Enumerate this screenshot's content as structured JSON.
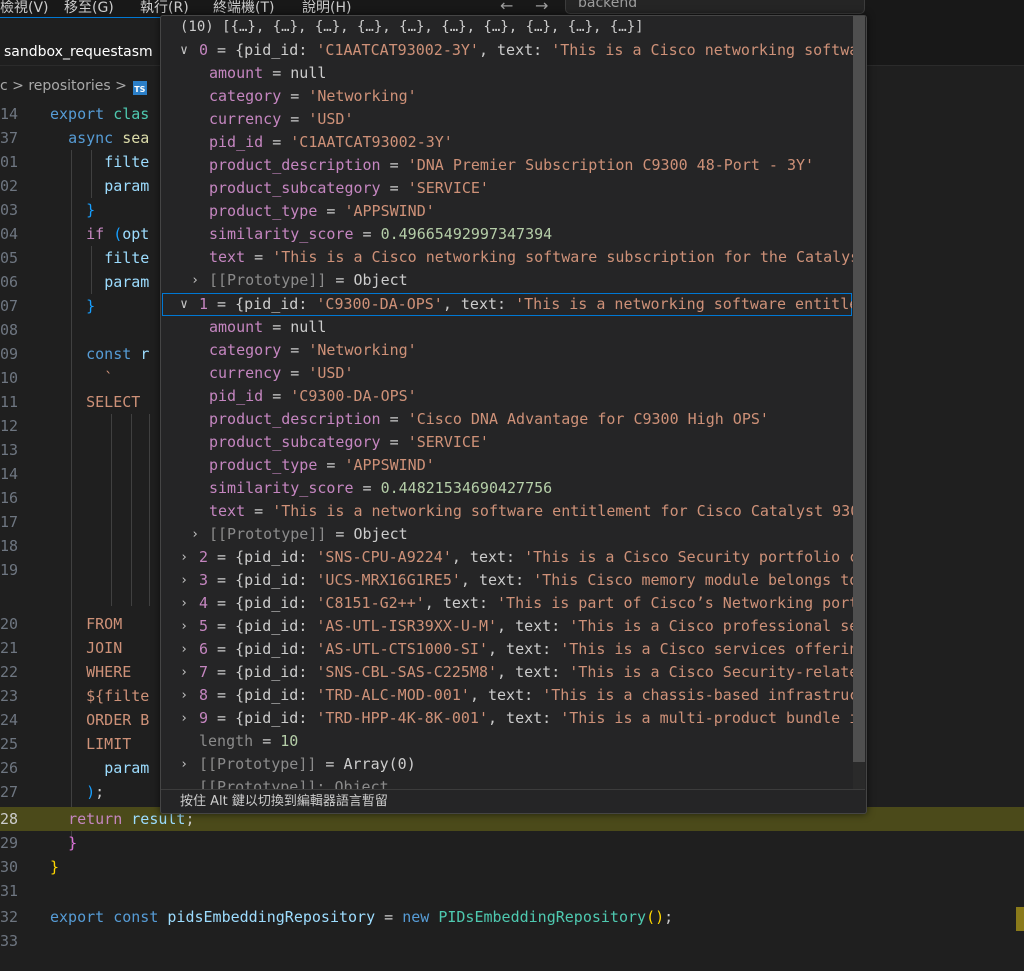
{
  "menubar": {
    "items": [
      "檢視(V)",
      "移至(G)",
      "執行(R)",
      "終端機(T)",
      "說明(H)"
    ],
    "back_icon": "←",
    "forward_icon": "→",
    "search_text": "backend"
  },
  "tab": {
    "label": "sandbox_requestasm"
  },
  "breadcrumb": {
    "text": "c > repositories >",
    "ts_badge": "TS"
  },
  "editor": {
    "lines": [
      {
        "ln": "14"
      },
      {
        "ln": "37"
      },
      {
        "ln": "01"
      },
      {
        "ln": "02"
      },
      {
        "ln": "03"
      },
      {
        "ln": "04"
      },
      {
        "ln": "05"
      },
      {
        "ln": "06"
      },
      {
        "ln": "07"
      },
      {
        "ln": "08"
      },
      {
        "ln": "09"
      },
      {
        "ln": "10"
      },
      {
        "ln": "11"
      },
      {
        "ln": "12"
      },
      {
        "ln": "13"
      },
      {
        "ln": "14"
      },
      {
        "ln": "16"
      },
      {
        "ln": "17"
      },
      {
        "ln": "18"
      },
      {
        "ln": "19"
      },
      {
        "ln": "20"
      },
      {
        "ln": "21"
      },
      {
        "ln": "22"
      },
      {
        "ln": "23"
      },
      {
        "ln": "24"
      },
      {
        "ln": "25"
      },
      {
        "ln": "26"
      },
      {
        "ln": "27"
      },
      {
        "ln": "28"
      },
      {
        "ln": "29"
      },
      {
        "ln": "30"
      },
      {
        "ln": "31"
      },
      {
        "ln": "32"
      },
      {
        "ln": "33"
      }
    ],
    "code": {
      "l0_kw": "export",
      "l0_cls": "clas",
      "l1_kw": "async",
      "l1_fn": "sea",
      "l2_var": "filte",
      "l3_var": "param",
      "l4_br": "}",
      "l5_kw": "if",
      "l5_br": "(",
      "l5_var": "opt",
      "l6_var": "filte",
      "l7_var": "param",
      "l8_br": "}",
      "l10_kw": "const",
      "l10_var": "r",
      "l11_str": "`",
      "l12_str": "SELECT",
      "l20_str": "FROM",
      "l21_str": "JOIN",
      "l22_str": "WHERE",
      "l23_str": "${filte",
      "l24_str": "ORDER B",
      "l25_str": "LIMIT",
      "l26_var": "param",
      "l27_br": ")",
      "l27_pun": ";",
      "l28_kw": "return",
      "l28_var": "result",
      "l28_pun": ";",
      "l29_br": "}",
      "l30_br": "}",
      "l32_kw1": "export",
      "l32_kw2": "const",
      "l32_var": "pidsEmbeddingRepository",
      "l32_eq": "=",
      "l32_new": "new",
      "l32_cls": "PIDsEmbeddingRepository",
      "l32_br": "()",
      "l32_pun": ";"
    }
  },
  "hover": {
    "summary": "(10) [{…}, {…}, {…}, {…}, {…}, {…}, {…}, {…}, {…}, {…}]",
    "item0": {
      "index": "0",
      "preview_pid": "'C1AATCAT93002-3Y'",
      "preview_text": "'This is a Cisco networking softwa",
      "amount": "null",
      "category": "'Networking'",
      "currency": "'USD'",
      "pid_id": "'C1AATCAT93002-3Y'",
      "product_description": "'DNA Premier Subscription C9300 48-Port - 3Y'",
      "product_subcategory": "'SERVICE'",
      "product_type": "'APPSWIND'",
      "similarity_score": "0.49665492997347394",
      "text": "'This is a Cisco networking software subscription for the Catalys"
    },
    "item1": {
      "index": "1",
      "preview_pid": "'C9300-DA-OPS'",
      "preview_text": "'This is a networking software entitle",
      "amount": "null",
      "category": "'Networking'",
      "currency": "'USD'",
      "pid_id": "'C9300-DA-OPS'",
      "product_description": "'Cisco DNA Advantage for C9300 High OPS'",
      "product_subcategory": "'SERVICE'",
      "product_type": "'APPSWIND'",
      "similarity_score": "0.44821534690427756",
      "text": "'This is a networking software entitlement for Cisco Catalyst 930"
    },
    "prototype_label": "[[Prototype]]",
    "object_label": "Object",
    "keys": {
      "amount": "amount",
      "category": "category",
      "currency": "currency",
      "pid_id": "pid_id",
      "product_description": "product_description",
      "product_subcategory": "product_subcategory",
      "product_type": "product_type",
      "similarity_score": "similarity_score",
      "text": "text"
    },
    "collapsed": [
      {
        "index": "2",
        "pid": "'SNS-CPU-A9224'",
        "text": "'This is a Cisco Security portfolio c"
      },
      {
        "index": "3",
        "pid": "'UCS-MRX16G1RE5'",
        "text": "'This Cisco memory module belongs to"
      },
      {
        "index": "4",
        "pid": "'C8151-G2++'",
        "text": "'This is part of Cisco’s Networking port"
      },
      {
        "index": "5",
        "pid": "'AS-UTL-ISR39XX-U-M'",
        "text": "'This is a Cisco professional se"
      },
      {
        "index": "6",
        "pid": "'AS-UTL-CTS1000-SI'",
        "text": "'This is a Cisco services offerin"
      },
      {
        "index": "7",
        "pid": "'SNS-CBL-SAS-C225M8'",
        "text": "'This is a Cisco Security-relate"
      },
      {
        "index": "8",
        "pid": "'TRD-ALC-MOD-001'",
        "text": "'This is a chassis-based infrastruc"
      },
      {
        "index": "9",
        "pid": "'TRD-HPP-4K-8K-001'",
        "text": "'This is a multi-product bundle i"
      }
    ],
    "length_key": "length",
    "length_value": "10",
    "array_proto_value": "Array(0)",
    "partial_proto": "[[Prototype]]: Object",
    "status_text": "按住 Alt 鍵以切換到編輯器語言暫留"
  }
}
